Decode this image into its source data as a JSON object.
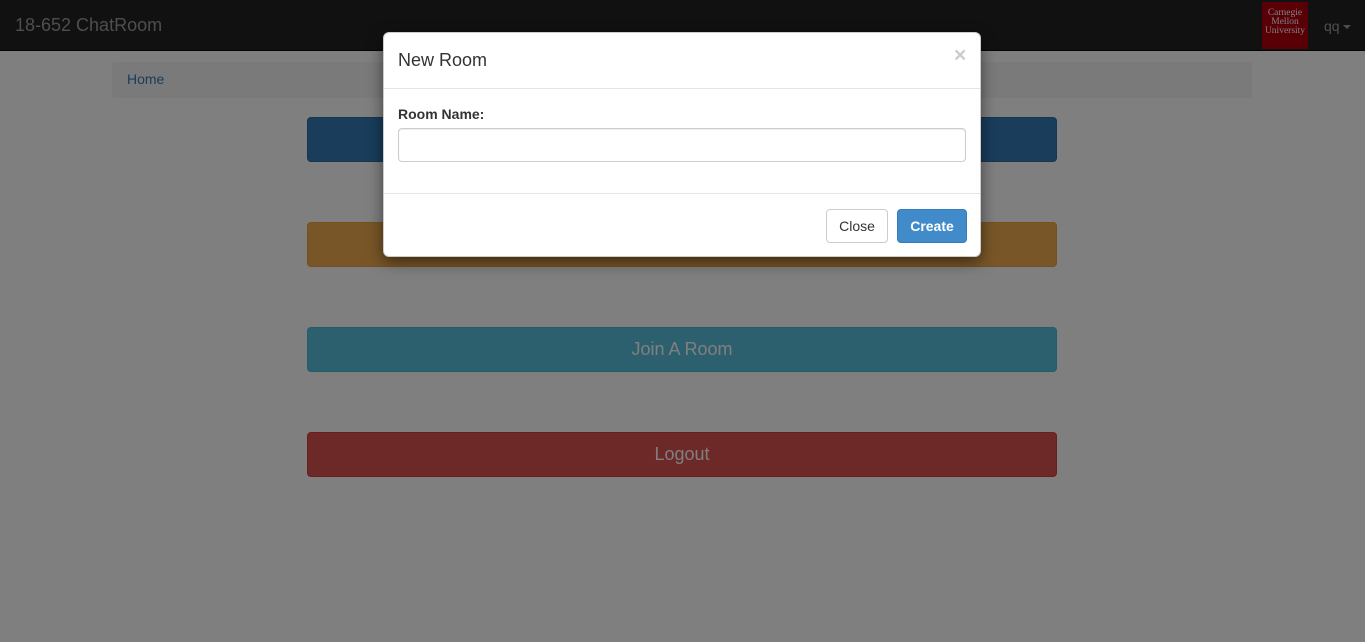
{
  "navbar": {
    "brand": "18-652 ChatRoom",
    "logo": {
      "line1": "Carnegie",
      "line2": "Mellon",
      "line3": "University",
      "color": "#b3000f"
    },
    "user": "qq",
    "user_caret_icon": "caret-down-icon"
  },
  "breadcrumb": {
    "home": "Home"
  },
  "main": {
    "buttons": [
      {
        "label": "",
        "color": "#337ab7"
      },
      {
        "label": "",
        "color": "#f0ad4e"
      },
      {
        "label": "Join A Room",
        "color": "#5bc0de"
      },
      {
        "label": "Logout",
        "color": "#d9534f"
      }
    ]
  },
  "modal": {
    "title": "New Room",
    "close_icon": "close-icon",
    "room_name_label": "Room Name:",
    "room_name_value": "",
    "close_label": "Close",
    "create_label": "Create"
  }
}
